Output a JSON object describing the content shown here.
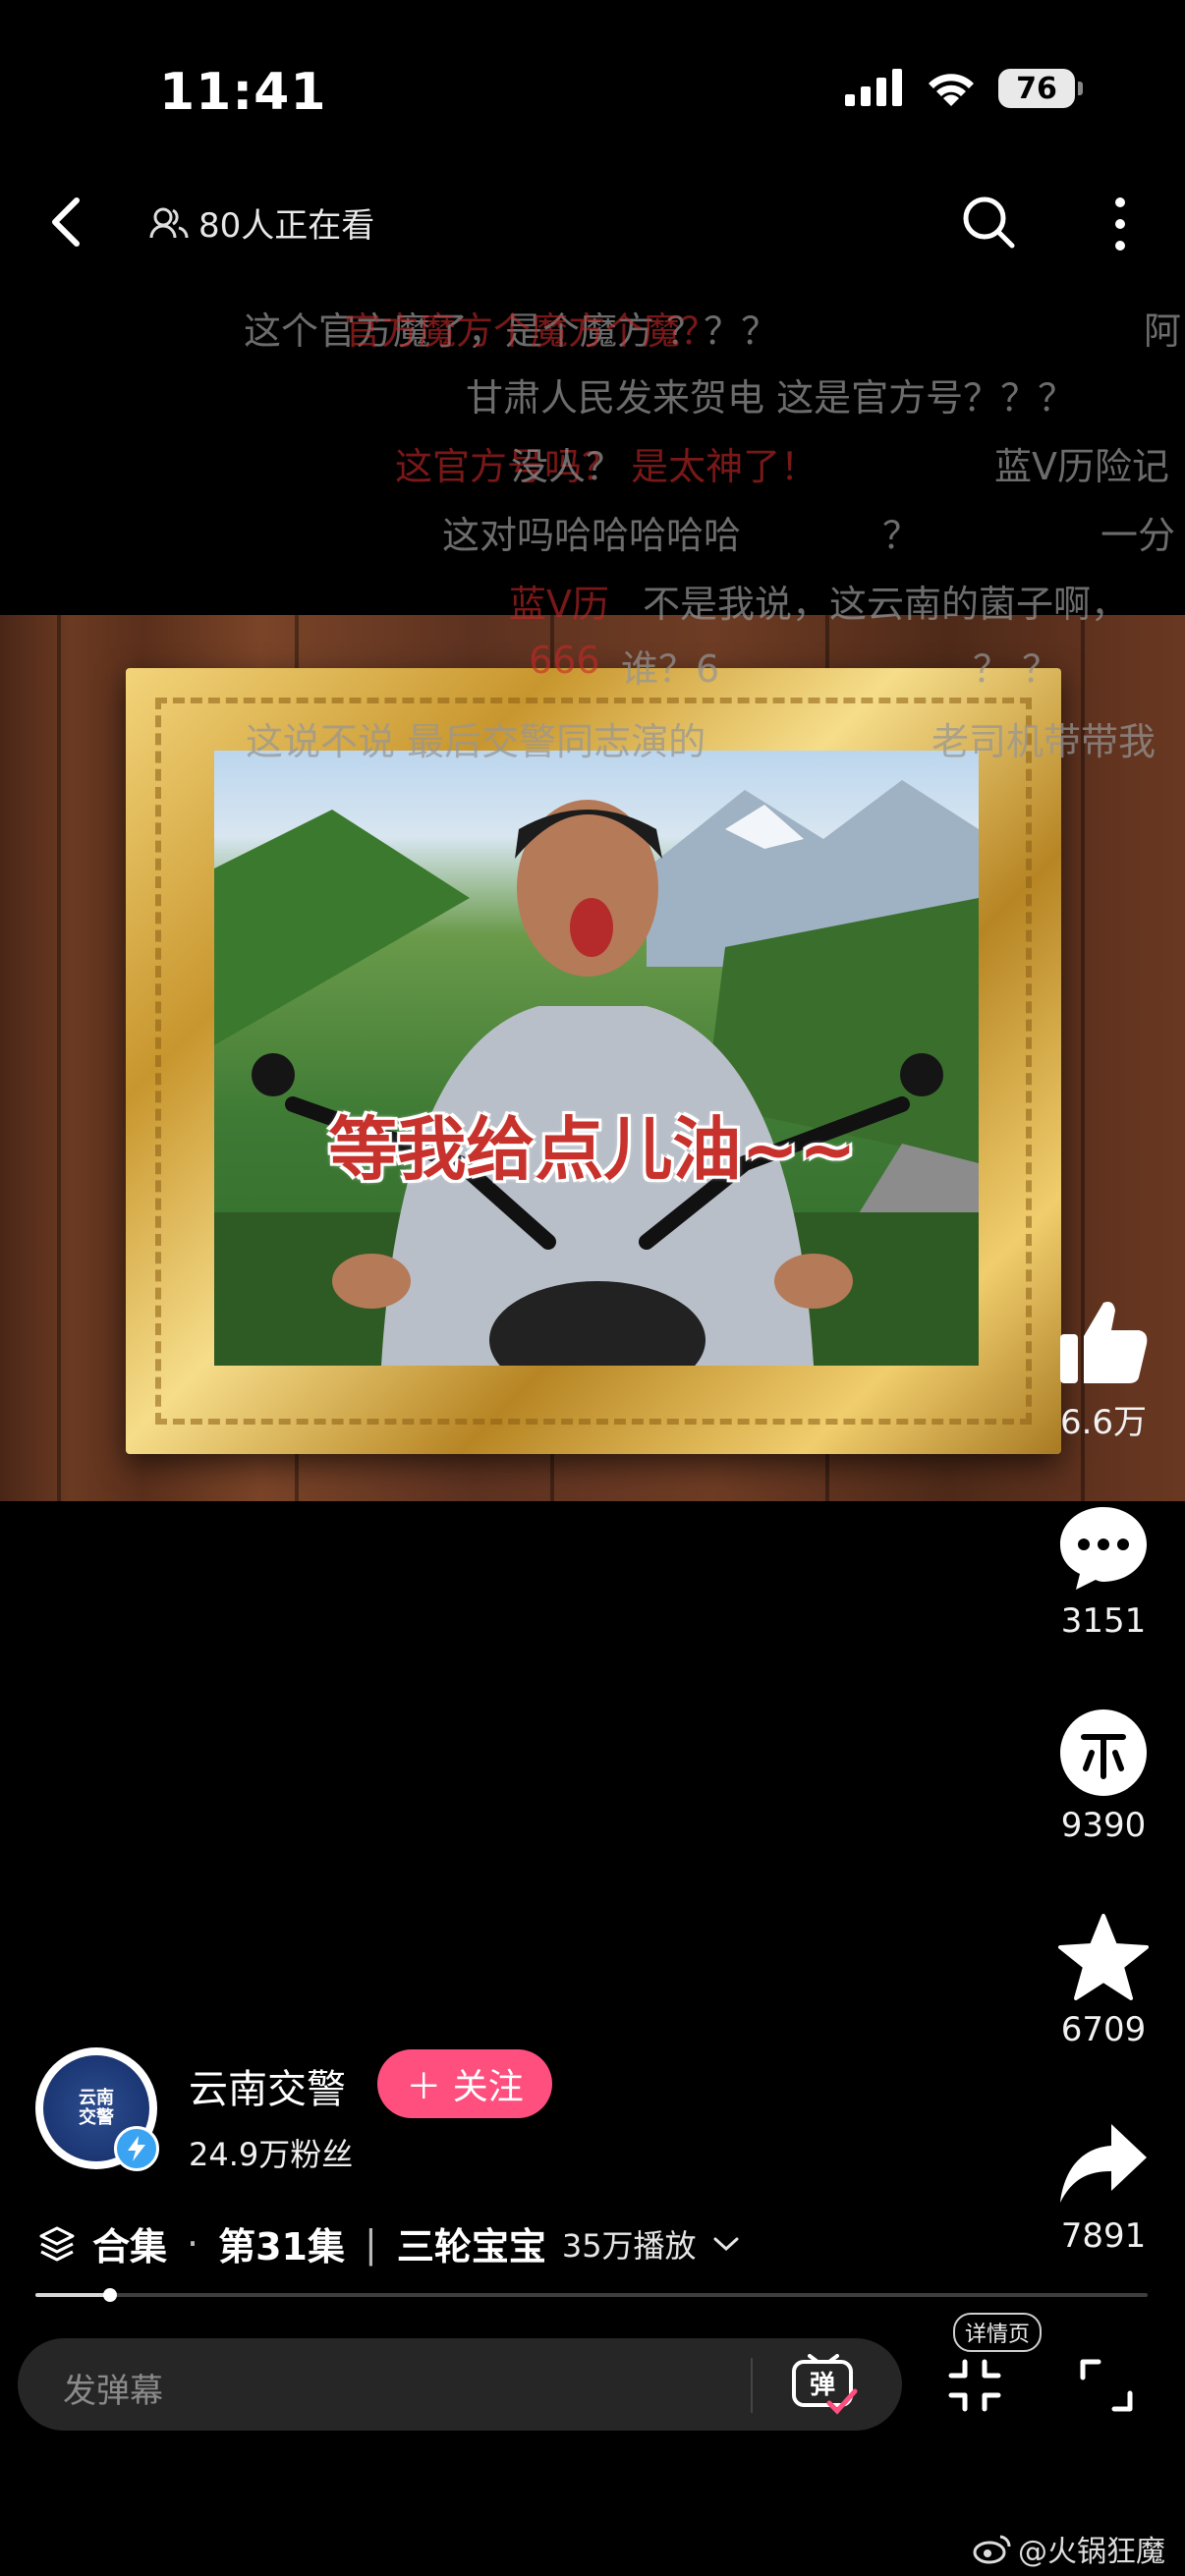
{
  "status_bar": {
    "time": "11:41",
    "battery": "76"
  },
  "header": {
    "viewers": "80人正在看"
  },
  "danmaku": [
    {
      "text": "这个官方魔了，是个魔方 ？？？",
      "style": "dark"
    },
    {
      "text": "官方魔方个魔方个魔？",
      "style": "red"
    },
    {
      "text": "阿",
      "style": "dark"
    },
    {
      "text": "甘肃人民发来贺电  这是官方号？？？",
      "style": "dark"
    },
    {
      "text": "这官方号吗？  是太神了！",
      "style": "red"
    },
    {
      "text": "没人？",
      "style": "dark"
    },
    {
      "text": "蓝V历险记",
      "style": "dark"
    },
    {
      "text": "这对吗哈哈哈哈哈",
      "style": "dark"
    },
    {
      "text": "？",
      "style": "dark"
    },
    {
      "text": "一分",
      "style": "dark"
    },
    {
      "text": "蓝V历",
      "style": "red"
    },
    {
      "text": "不是我说，这云南的菌子啊，",
      "style": "dark"
    },
    {
      "text": "666",
      "style": "red"
    },
    {
      "text": "谁？6",
      "style": "dark"
    },
    {
      "text": "？   ？",
      "style": "dark"
    },
    {
      "text": "这说不说 最后交警同志演的",
      "style": "dark"
    },
    {
      "text": "老司机带带我",
      "style": "dark"
    }
  ],
  "video": {
    "caption": "等我给点儿油~~"
  },
  "rail": {
    "likes": "6.6万",
    "comments": "3151",
    "coins": "9390",
    "favorites": "6709",
    "shares": "7891"
  },
  "creator": {
    "name": "云南交警",
    "follow_label": "＋ 关注",
    "fans": "24.9万粉丝",
    "avatar_text": "云南\n交警"
  },
  "collection": {
    "label": "合集",
    "episode": "第31集",
    "title": "三轮宝宝",
    "plays": "35万播放"
  },
  "playback": {
    "progress_fraction": 0.067
  },
  "bottom": {
    "danmaku_placeholder": "发弹幕",
    "danmaku_toggle": "弹",
    "detail_badge": "详情页"
  },
  "watermark": "@火锅狂魔",
  "colors": {
    "follow": "#fe4f7e",
    "caption": "#c8322c",
    "verified": "#3aa3f2"
  },
  "icons": [
    "back-icon",
    "viewers-icon",
    "search-icon",
    "more-icon",
    "like-icon",
    "comment-icon",
    "coin-icon",
    "star-icon",
    "share-icon",
    "collection-icon",
    "chevron-down-icon",
    "danmaku-toggle-icon",
    "collapse-icon",
    "fullscreen-icon",
    "weibo-icon"
  ]
}
